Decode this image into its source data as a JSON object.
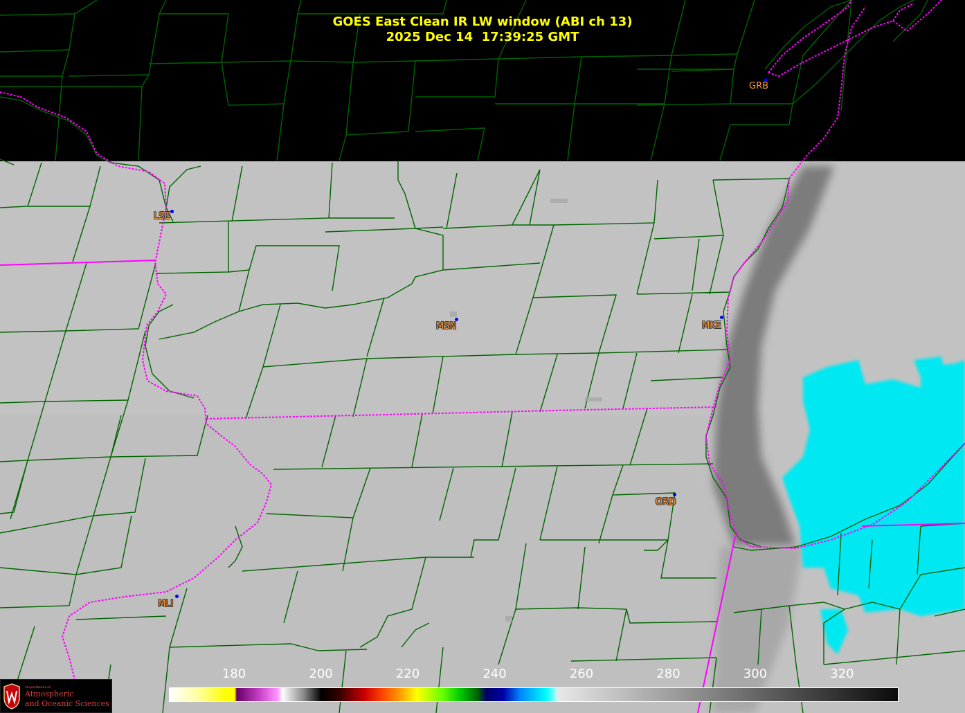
{
  "title": {
    "line1": "GOES East Clean IR LW window (ABI ch 13)",
    "line2": "2025 Dec 14  17:39:25 GMT"
  },
  "stations": [
    {
      "id": "GRB",
      "label": "GRB"
    },
    {
      "id": "LSE",
      "label": "LSE"
    },
    {
      "id": "MSN",
      "label": "MSN"
    },
    {
      "id": "MKE",
      "label": "MKE"
    },
    {
      "id": "ORD",
      "label": "ORD"
    },
    {
      "id": "MLI",
      "label": "MLI"
    }
  ],
  "colorbar": {
    "tick_labels": [
      "180",
      "200",
      "220",
      "240",
      "260",
      "280",
      "300",
      "320"
    ],
    "ticks": [
      180,
      200,
      220,
      240,
      260,
      280,
      300,
      320
    ],
    "range": [
      165,
      333
    ]
  },
  "logo": {
    "line1": "Department of",
    "line2": "Atmospheric",
    "line3": "and Oceanic Sciences"
  },
  "colors": {
    "title": "#ffff00",
    "county_lines": "#006400",
    "state_lines": "#ff00ff",
    "station_label": "#ff9933",
    "station_dot": "#0000ff",
    "cloud_cyan": "#00e5f0",
    "land_gray": "#c0c0c0",
    "no_data": "#000000"
  }
}
